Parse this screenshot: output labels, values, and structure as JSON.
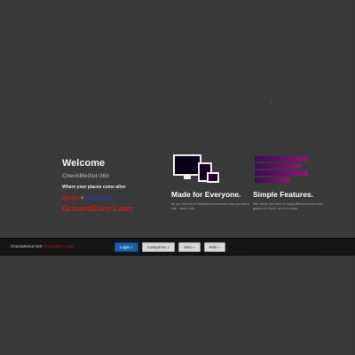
{
  "welcome": {
    "title": "Welcome",
    "app_name": "CheckMeOut-360",
    "tagline": "Where your places come alive",
    "design_by": "design",
    "plus": "+",
    "dev_by": "develop by",
    "studio": "GroundZero Labs"
  },
  "features": [
    {
      "icon": "devices-icon",
      "title": "Made for Everyone.",
      "desc_a": "All you need is a Facebook Account and now you set to use ",
      "desc_hl": "it",
      "desc_b": " share now"
    },
    {
      "icon": "bar-chart-icon",
      "title": "Simple Features.",
      "desc": "See where you been in many different forms from graphs to charts, so on to maps."
    }
  ],
  "footer": {
    "credit_prefix": "CheckMeOut-360 ",
    "credit_studio": "GroundZero Labs",
    "nav": [
      "Login »",
      "Categories »",
      "Wiki »",
      "Wiki »"
    ]
  },
  "colors": {
    "background": "#393939",
    "accent_red": "#d01818",
    "accent_blue": "#2a38b8",
    "accent_gold": "#d8b020",
    "login_blue": "#1c5fb0"
  }
}
